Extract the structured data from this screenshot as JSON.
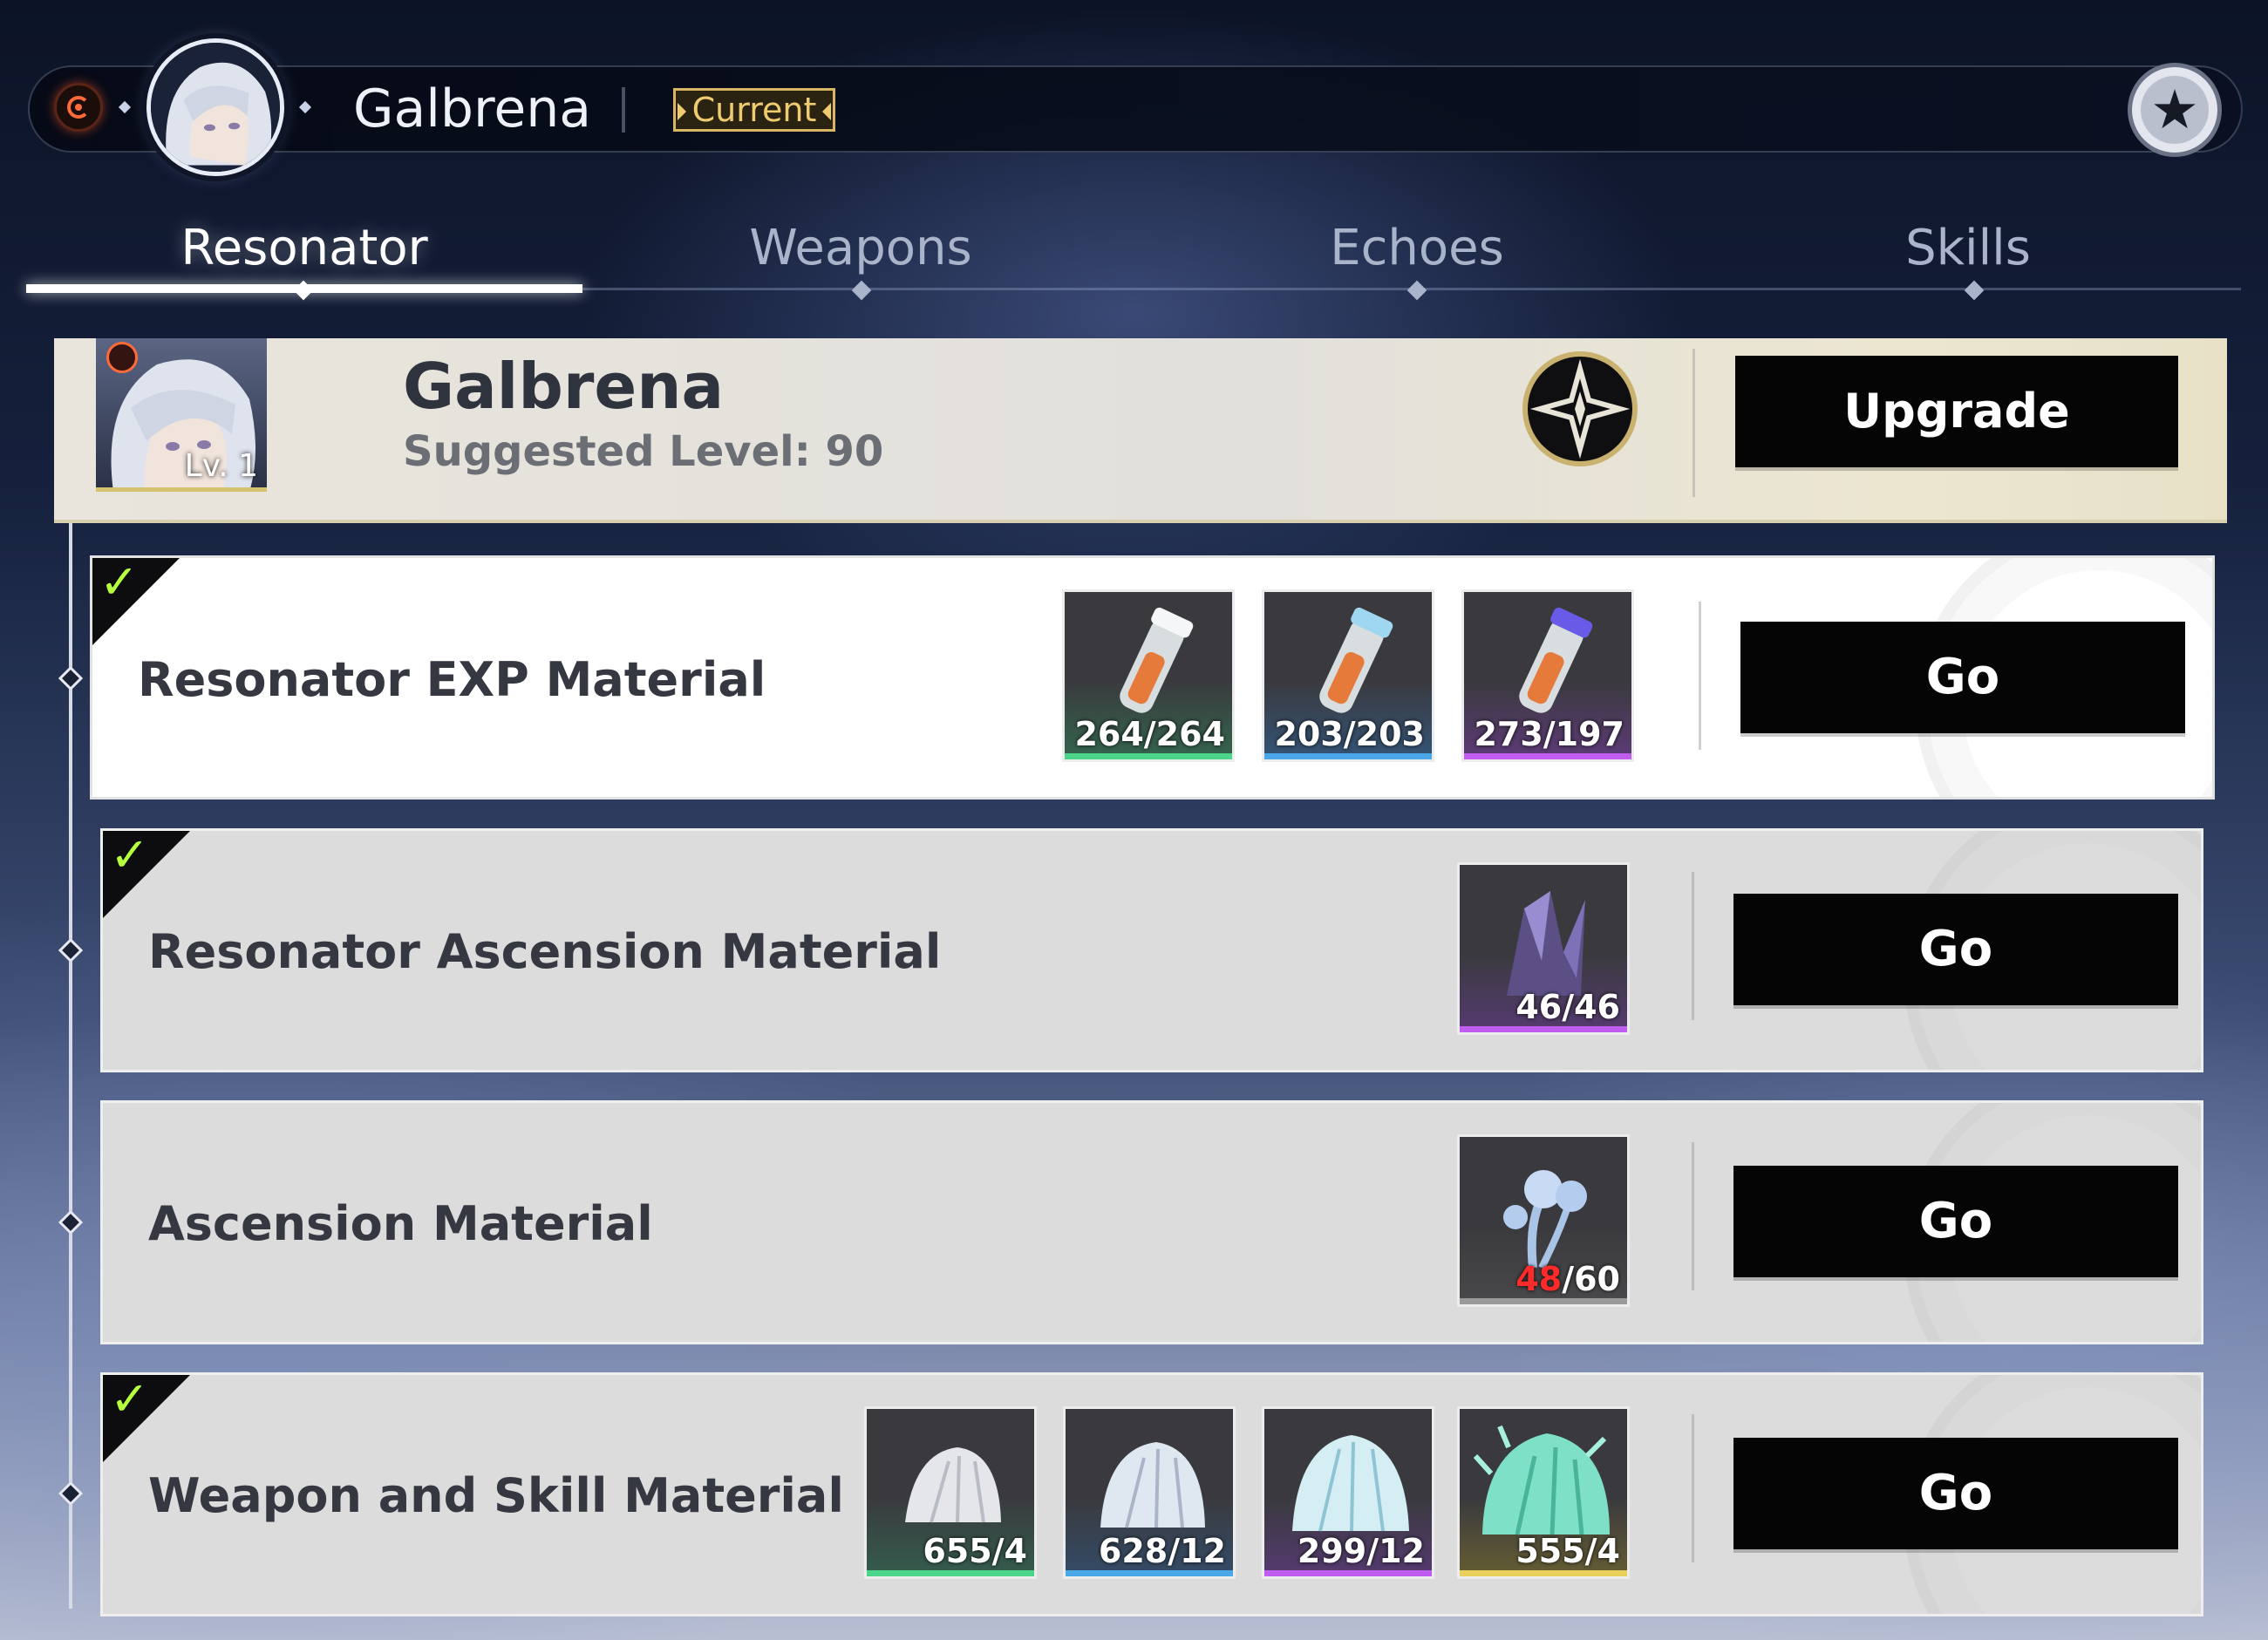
{
  "header": {
    "character_name": "Galbrena",
    "current_badge": "Current",
    "favorite_icon": "star-icon",
    "element_icon": "fusion-element-icon"
  },
  "tabs": [
    {
      "label": "Resonator",
      "active": true
    },
    {
      "label": "Weapons",
      "active": false
    },
    {
      "label": "Echoes",
      "active": false
    },
    {
      "label": "Skills",
      "active": false
    }
  ],
  "panel": {
    "name": "Galbrena",
    "suggested_level": "Suggested Level: 90",
    "level_badge": "Lv. 1",
    "upgrade_label": "Upgrade",
    "emblem_icon": "compass-star-icon"
  },
  "materials": [
    {
      "label": "Resonator EXP Material",
      "complete": true,
      "go_label": "Go",
      "items": [
        {
          "have": "264",
          "need": "264",
          "rarity_color": "#4ad58a",
          "sufficient": true
        },
        {
          "have": "203",
          "need": "203",
          "rarity_color": "#4aa8e8",
          "sufficient": true
        },
        {
          "have": "273",
          "need": "197",
          "rarity_color": "#c05cf0",
          "sufficient": true
        }
      ]
    },
    {
      "label": "Resonator Ascension Material",
      "complete": true,
      "go_label": "Go",
      "items": [
        {
          "have": "46",
          "need": "46",
          "rarity_color": "#c05cf0",
          "sufficient": true
        }
      ]
    },
    {
      "label": "Ascension Material",
      "complete": false,
      "go_label": "Go",
      "items": [
        {
          "have": "48",
          "need": "60",
          "rarity_color": "#9a9a9a",
          "sufficient": false
        }
      ]
    },
    {
      "label": "Weapon and Skill Material",
      "complete": true,
      "go_label": "Go",
      "items": [
        {
          "have": "655",
          "need": "4",
          "rarity_color": "#4ad58a",
          "sufficient": true
        },
        {
          "have": "628",
          "need": "12",
          "rarity_color": "#4aa8e8",
          "sufficient": true
        },
        {
          "have": "299",
          "need": "12",
          "rarity_color": "#c05cf0",
          "sufficient": true
        },
        {
          "have": "555",
          "need": "4",
          "rarity_color": "#e8d05a",
          "sufficient": true
        }
      ]
    }
  ],
  "colors": {
    "accent_gold": "#d8b664",
    "check_green": "#b6ff3c",
    "insufficient_red": "#ff2a2a"
  }
}
